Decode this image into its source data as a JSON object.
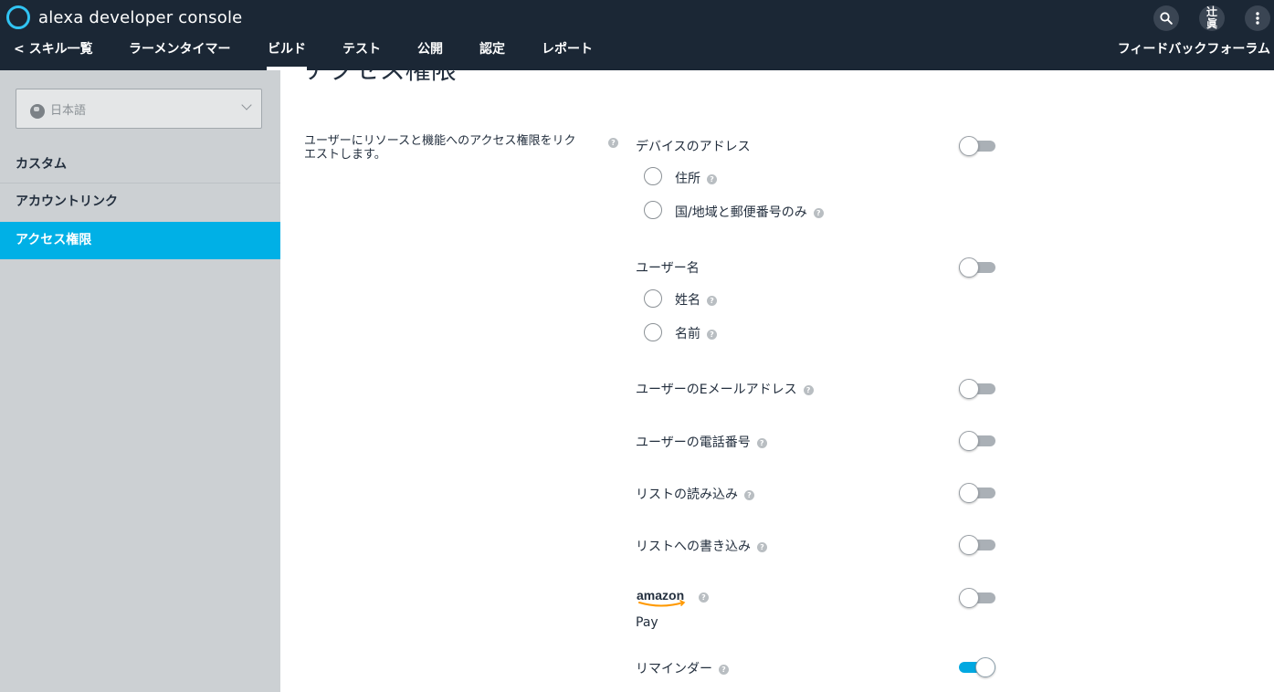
{
  "header": {
    "app_title": "alexa developer console",
    "user_initials": [
      "辻",
      "眞"
    ],
    "feedback_label": "フィードバックフォーラム",
    "nav": [
      {
        "label": "< スキル一覧"
      },
      {
        "label": "ラーメンタイマー"
      },
      {
        "label": "ビルド"
      },
      {
        "label": "テスト"
      },
      {
        "label": "公開"
      },
      {
        "label": "認定"
      },
      {
        "label": "レポート"
      }
    ],
    "active_nav": "ビルド"
  },
  "sidebar": {
    "language": "日本語",
    "items": [
      {
        "label": "カスタム"
      },
      {
        "label": "アカウントリンク"
      },
      {
        "label": "アクセス権限"
      }
    ],
    "active_item": "アクセス権限"
  },
  "main": {
    "page_title": "アクセス権限",
    "description": "ユーザーにリソースと機能へのアクセス権限をリクエストします。",
    "permissions": {
      "device_address": {
        "label": "デバイスのアドレス",
        "enabled": false
      },
      "address_full": {
        "label": "住所"
      },
      "address_country": {
        "label": "国/地域と郵便番号のみ"
      },
      "user_name": {
        "label": "ユーザー名",
        "enabled": false
      },
      "name_full": {
        "label": "姓名"
      },
      "name_first": {
        "label": "名前"
      },
      "email": {
        "label": "ユーザーのEメールアドレス",
        "enabled": false
      },
      "phone": {
        "label": "ユーザーの電話番号",
        "enabled": false
      },
      "list_read": {
        "label": "リストの読み込み",
        "enabled": false
      },
      "list_write": {
        "label": "リストへの書き込み",
        "enabled": false
      },
      "amazon_pay": {
        "logo_text": "amazon",
        "label": "Pay",
        "enabled": false
      },
      "reminders": {
        "label": "リマインダー",
        "enabled": true
      }
    },
    "help_glyph": "?"
  },
  "colors": {
    "header_bg": "#1b2735",
    "accent": "#00b0e6",
    "alexa_ring": "#31c4f3",
    "sidebar_bg": "#ccd0d3",
    "amazon_orange": "#ff9900"
  },
  "icons": [
    "alexa-logo-icon",
    "search-icon",
    "more-vertical-icon",
    "globe-icon",
    "chevron-down-icon",
    "help-icon",
    "amazon-smile-icon"
  ]
}
